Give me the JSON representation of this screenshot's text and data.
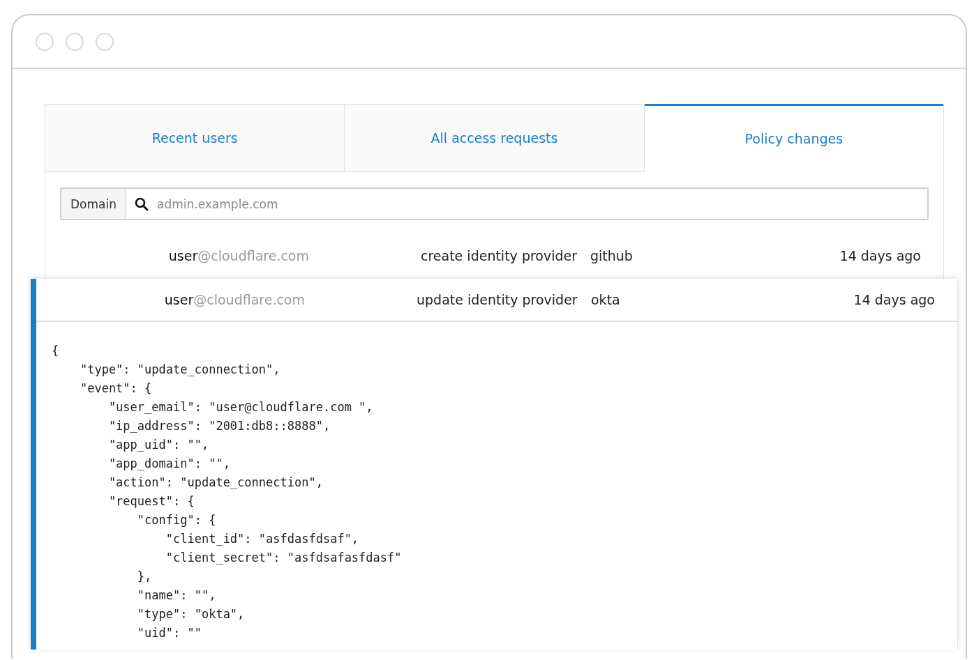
{
  "tabs": [
    {
      "label": "Recent users",
      "selected": false
    },
    {
      "label": "All access requests",
      "selected": false
    },
    {
      "label": "Policy changes",
      "selected": true
    }
  ],
  "search": {
    "label": "Domain",
    "placeholder": "admin.example.com"
  },
  "rows": [
    {
      "user": "user",
      "domain": "@cloudflare.com",
      "action": "create identity provider",
      "provider": "github",
      "time": "14 days ago",
      "expanded": false
    },
    {
      "user": "user",
      "domain": "@cloudflare.com",
      "action": "update identity provider",
      "provider": "okta",
      "time": "14 days ago",
      "expanded": true,
      "details": [
        "{",
        "    \"type\": \"update_connection\",",
        "    \"event\": {",
        "        \"user_email\": \"user@cloudflare.com \",",
        "        \"ip_address\": \"2001:db8::8888\",",
        "        \"app_uid\": \"\",",
        "        \"app_domain\": \"\",",
        "        \"action\": \"update_connection\",",
        "        \"request\": {",
        "            \"config\": {",
        "                \"client_id\": \"asfdasfdsaf\",",
        "                \"client_secret\": \"asfdsafasfdasf\"",
        "            },",
        "            \"name\": \"\",",
        "            \"type\": \"okta\",",
        "            \"uid\": \"\""
      ]
    }
  ]
}
